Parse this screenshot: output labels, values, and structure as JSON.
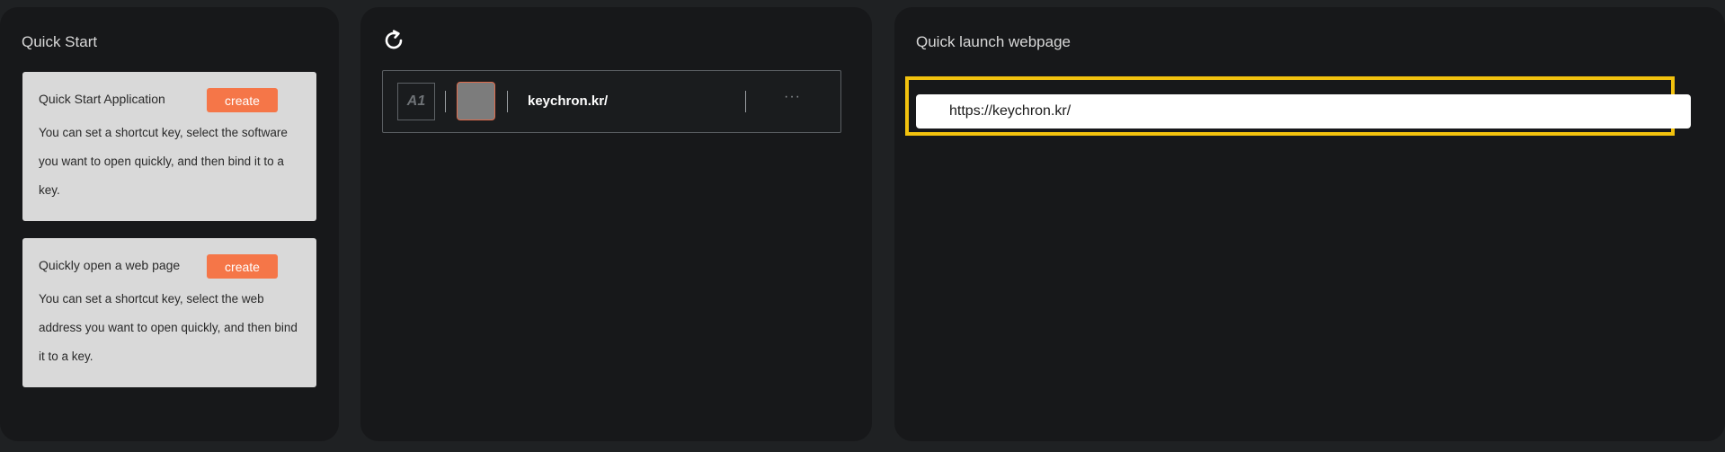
{
  "quick_start": {
    "title": "Quick Start",
    "cards": [
      {
        "title": "Quick Start Application",
        "button": "create",
        "description": "You can set a shortcut key, select the software you want to open quickly, and then bind it to a key."
      },
      {
        "title": "Quickly open a web page",
        "button": "create",
        "description": "You can set a shortcut key, select the web address you want to open quickly, and then bind it to a key."
      }
    ]
  },
  "shortcuts": {
    "refresh_icon": "refresh-icon",
    "entries": [
      {
        "key": "A1",
        "label": "keychron.kr/",
        "more": "···"
      }
    ]
  },
  "webpage": {
    "title": "Quick launch webpage",
    "url": "https://keychron.kr/",
    "highlight_color": "#f2c20e"
  },
  "colors": {
    "accent": "#f57648",
    "background": "#1f2123",
    "panel": "#17181a",
    "card": "#d9d9d9"
  }
}
